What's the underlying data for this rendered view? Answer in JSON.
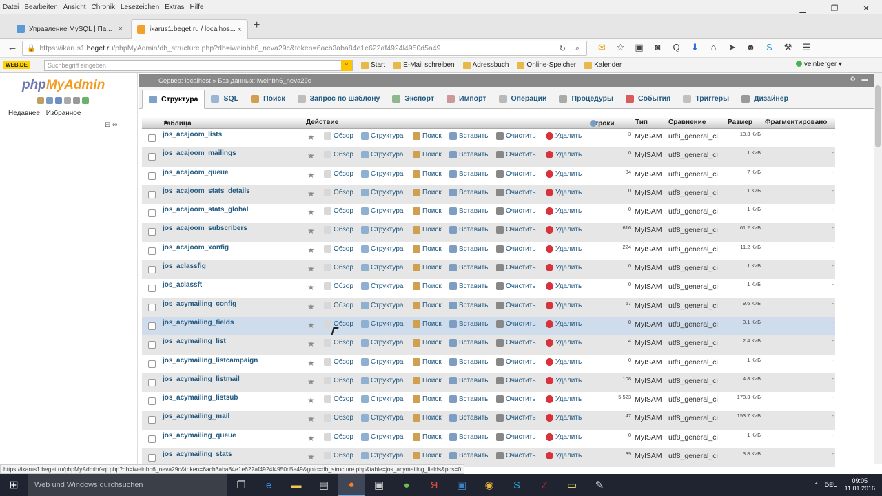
{
  "menubar": [
    "Datei",
    "Bearbeiten",
    "Ansicht",
    "Chronik",
    "Lesezeichen",
    "Extras",
    "Hilfe"
  ],
  "tabs": [
    {
      "title": "Управление MySQL | Па...",
      "close": "×"
    },
    {
      "title": "ikarus1.beget.ru / localhos...",
      "close": "×"
    }
  ],
  "newtab": "+",
  "url": {
    "prefix": "https://ikarus1.",
    "host": "beget.ru",
    "path": "/phpMyAdmin/db_structure.php?db=iweinbh6_neva29c&token=6acb3aba84e1e622af4924l4950d5a49"
  },
  "bookmarks": {
    "webde": "WEB.DE",
    "search_placeholder": "Suchbegriff eingeben",
    "items": [
      "Start",
      "E-Mail schreiben",
      "Adressbuch",
      "Online-Speicher",
      "Kalender"
    ],
    "user": "veinberger"
  },
  "sidebar": {
    "logo_php": "php",
    "logo_my": "MyAdmin",
    "recent": "Недавнее",
    "favorites": "Избранное"
  },
  "crumbs": "Сервер: localhost » Баз данных: iweinbh6_neva29c",
  "pma_tabs": [
    {
      "label": "Структура",
      "active": true,
      "color": "#7da4c8"
    },
    {
      "label": "SQL",
      "active": false,
      "color": "#9bb5d6"
    },
    {
      "label": "Поиск",
      "active": false,
      "color": "#d0a050"
    },
    {
      "label": "Запрос по шаблону",
      "active": false,
      "color": "#bdbdbd"
    },
    {
      "label": "Экспорт",
      "active": false,
      "color": "#8fb78f"
    },
    {
      "label": "Импорт",
      "active": false,
      "color": "#c99"
    },
    {
      "label": "Операции",
      "active": false,
      "color": "#b9b9b9"
    },
    {
      "label": "Процедуры",
      "active": false,
      "color": "#a9a9a9"
    },
    {
      "label": "События",
      "active": false,
      "color": "#d95b5b"
    },
    {
      "label": "Триггеры",
      "active": false,
      "color": "#c0c0c0"
    },
    {
      "label": "Дизайнер",
      "active": false,
      "color": "#999"
    }
  ],
  "table": {
    "headers": {
      "table": "Таблица",
      "action": "Действие",
      "rows": "Строки",
      "type": "Тип",
      "collation": "Сравнение",
      "size": "Размер",
      "overhead": "Фрагментировано"
    },
    "action_labels": {
      "browse": "Обзор",
      "structure": "Структура",
      "search": "Поиск",
      "insert": "Вставить",
      "empty": "Очистить",
      "drop": "Удалить"
    },
    "rows": [
      {
        "name": "jos_acajoom_lists",
        "rows": "3",
        "type": "MyISAM",
        "collation": "utf8_general_ci",
        "size": "13.3 КиБ",
        "overhead": "-"
      },
      {
        "name": "jos_acajoom_mailings",
        "rows": "0",
        "type": "MyISAM",
        "collation": "utf8_general_ci",
        "size": "1 КиБ",
        "overhead": "-"
      },
      {
        "name": "jos_acajoom_queue",
        "rows": "84",
        "type": "MyISAM",
        "collation": "utf8_general_ci",
        "size": "7 КиБ",
        "overhead": "-"
      },
      {
        "name": "jos_acajoom_stats_details",
        "rows": "0",
        "type": "MyISAM",
        "collation": "utf8_general_ci",
        "size": "1 КиБ",
        "overhead": "-"
      },
      {
        "name": "jos_acajoom_stats_global",
        "rows": "0",
        "type": "MyISAM",
        "collation": "utf8_general_ci",
        "size": "1 КиБ",
        "overhead": "-"
      },
      {
        "name": "jos_acajoom_subscribers",
        "rows": "616",
        "type": "MyISAM",
        "collation": "utf8_general_ci",
        "size": "61.2 КиБ",
        "overhead": "-"
      },
      {
        "name": "jos_acajoom_xonfig",
        "rows": "224",
        "type": "MyISAM",
        "collation": "utf8_general_ci",
        "size": "11.2 КиБ",
        "overhead": "-"
      },
      {
        "name": "jos_aclassfig",
        "rows": "0",
        "type": "MyISAM",
        "collation": "utf8_general_ci",
        "size": "1 КиБ",
        "overhead": "-"
      },
      {
        "name": "jos_aclassft",
        "rows": "0",
        "type": "MyISAM",
        "collation": "utf8_general_ci",
        "size": "1 КиБ",
        "overhead": "-"
      },
      {
        "name": "jos_acymailing_config",
        "rows": "57",
        "type": "MyISAM",
        "collation": "utf8_general_ci",
        "size": "9.6 КиБ",
        "overhead": "-"
      },
      {
        "name": "jos_acymailing_fields",
        "rows": "8",
        "type": "MyISAM",
        "collation": "utf8_general_ci",
        "size": "3.1 КиБ",
        "overhead": "-"
      },
      {
        "name": "jos_acymailing_list",
        "rows": "4",
        "type": "MyISAM",
        "collation": "utf8_general_ci",
        "size": "2.4 КиБ",
        "overhead": "-"
      },
      {
        "name": "jos_acymailing_listcampaign",
        "rows": "0",
        "type": "MyISAM",
        "collation": "utf8_general_ci",
        "size": "1 КиБ",
        "overhead": "-"
      },
      {
        "name": "jos_acymailing_listmail",
        "rows": "108",
        "type": "MyISAM",
        "collation": "utf8_general_ci",
        "size": "4.8 КиБ",
        "overhead": "-"
      },
      {
        "name": "jos_acymailing_listsub",
        "rows": "5,523",
        "type": "MyISAM",
        "collation": "utf8_general_ci",
        "size": "178.3 КиБ",
        "overhead": "-"
      },
      {
        "name": "jos_acymailing_mail",
        "rows": "47",
        "type": "MyISAM",
        "collation": "utf8_general_ci",
        "size": "153.7 КиБ",
        "overhead": "-"
      },
      {
        "name": "jos_acymailing_queue",
        "rows": "0",
        "type": "MyISAM",
        "collation": "utf8_general_ci",
        "size": "1 КиБ",
        "overhead": "-"
      },
      {
        "name": "jos_acymailing_stats",
        "rows": "39",
        "type": "MyISAM",
        "collation": "utf8_general_ci",
        "size": "3.8 КиБ",
        "overhead": "-"
      }
    ],
    "hover_row": 10
  },
  "status_url": "https://ikarus1.beget.ru/phpMyAdmin/sql.php?db=iweinbh6_neva29c&token=6acb3aba84e1e622af4924l4950d5a49&goto=db_structure.php&table=jos_acymailing_fields&pos=0",
  "taskbar": {
    "search": "Web und Windows durchsuchen",
    "lang": "DEU",
    "time": "09:05",
    "date": "11.01.2016"
  }
}
